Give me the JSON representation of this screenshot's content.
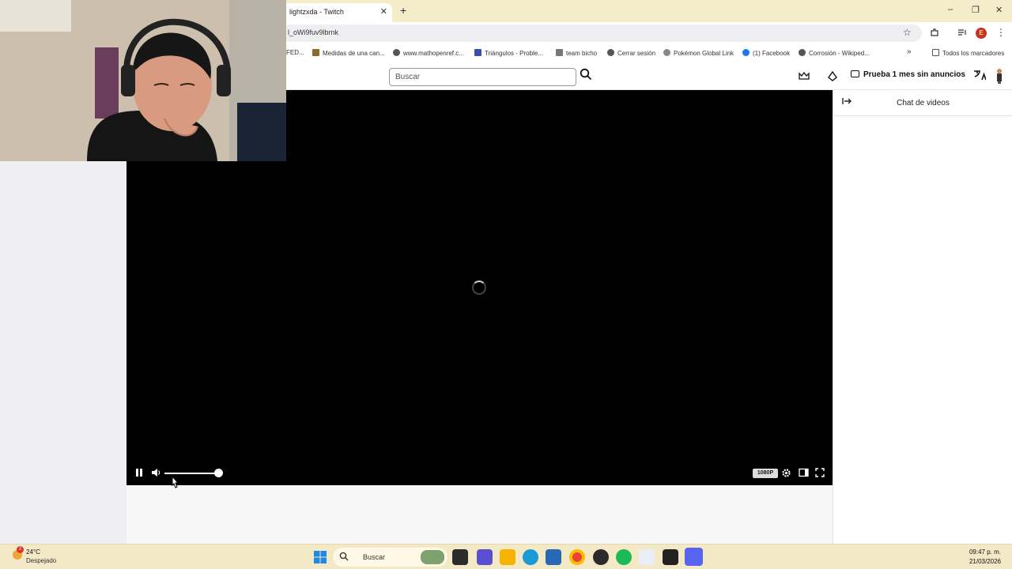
{
  "browser": {
    "tab_title": "lightzxda - Twitch",
    "tab_close": "✕",
    "new_tab": "+",
    "url": "l_oWi9fuv9lbrnk",
    "window_controls": [
      "–",
      "❐",
      "✕"
    ],
    "profile_initial": "E",
    "bookmarks": [
      {
        "label": "FED...",
        "icon": "page-icon"
      },
      {
        "label": "Medidas de una can...",
        "icon": "crown-icon"
      },
      {
        "label": "www.mathopenref.c...",
        "icon": "globe-icon"
      },
      {
        "label": "Triángulos - Proble...",
        "icon": "triangle-icon"
      },
      {
        "label": "team bicho",
        "icon": "table-icon"
      },
      {
        "label": "Cerrar sesión",
        "icon": "globe-icon"
      },
      {
        "label": "Pokémon Global Link",
        "icon": "pokeball-icon"
      },
      {
        "label": "(1) Facebook",
        "icon": "facebook-icon"
      },
      {
        "label": "Corrosión - Wikiped...",
        "icon": "globe-icon"
      }
    ],
    "bookmarks_overflow": "»",
    "all_bookmarks": "Todos los marcadores"
  },
  "twitch": {
    "search_placeholder": "Buscar",
    "promo_label": "Prueba 1 mes sin anuncios",
    "chat_title": "Chat de videos"
  },
  "player": {
    "quality": "1080P",
    "volume_fraction": 0.98,
    "state": "loading"
  },
  "taskbar": {
    "temperature": "24°C",
    "condition": "Despejado",
    "weather_badge": "2",
    "search_label": "Buscar",
    "time": "09:47 p. m.",
    "date": "21/03/2026"
  }
}
